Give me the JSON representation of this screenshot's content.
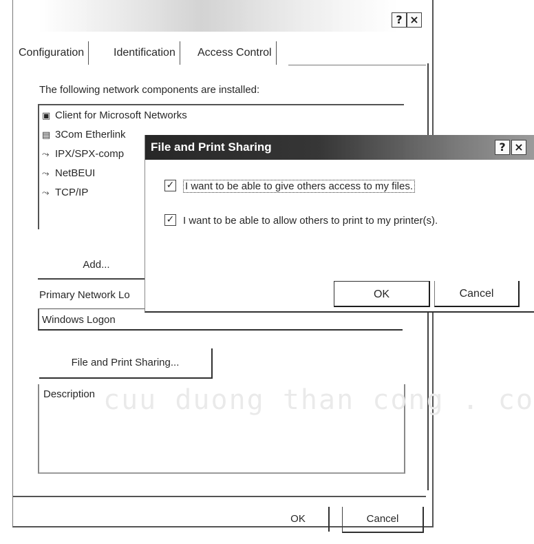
{
  "network_window": {
    "title_buttons": {
      "help": "?",
      "close": "×"
    },
    "tabs": [
      {
        "label": "Configuration"
      },
      {
        "label": "Identification"
      },
      {
        "label": "Access Control"
      }
    ],
    "components_label": "The following network components are installed:",
    "components": [
      {
        "label": "Client for Microsoft Networks",
        "icon": "client-icon"
      },
      {
        "label": "3Com Etherlink",
        "icon": "adapter-icon"
      },
      {
        "label": "IPX/SPX-comp",
        "icon": "protocol-icon"
      },
      {
        "label": "NetBEUI",
        "icon": "protocol-icon"
      },
      {
        "label": "TCP/IP",
        "icon": "protocol-icon"
      }
    ],
    "add_label": "Add...",
    "logon_label": "Primary Network Lo",
    "logon_value": "Windows Logon",
    "file_print_sharing_label": "File and Print Sharing...",
    "description_label": "Description",
    "ok_label": "OK",
    "cancel_label": "Cancel"
  },
  "fps_dialog": {
    "title": "File and Print Sharing",
    "title_buttons": {
      "help": "?",
      "close": "×"
    },
    "options": [
      {
        "label": "I want to be able to give others access to my files.",
        "checked": true
      },
      {
        "label": "I want to be able to allow others to print to my printer(s).",
        "checked": true
      }
    ],
    "ok_label": "OK",
    "cancel_label": "Cancel"
  },
  "watermark": "cuu duong than cong . com"
}
